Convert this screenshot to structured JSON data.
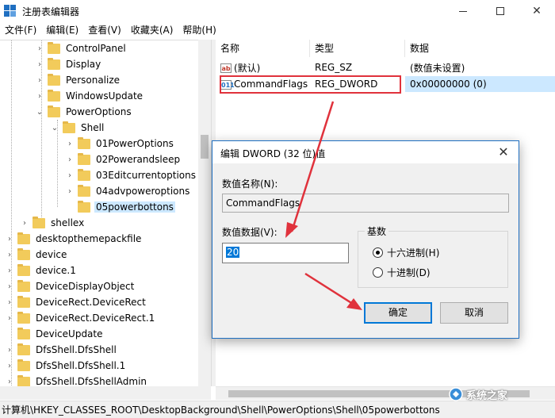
{
  "window": {
    "title": "注册表编辑器",
    "min_label": "",
    "close_label": "✕"
  },
  "menu": [
    "文件(F)",
    "编辑(E)",
    "查看(V)",
    "收藏夹(A)",
    "帮助(H)"
  ],
  "tree": {
    "items": [
      {
        "label": "ControlPanel",
        "expander": "›"
      },
      {
        "label": "Display",
        "expander": "›"
      },
      {
        "label": "Personalize",
        "expander": "›"
      },
      {
        "label": "WindowsUpdate",
        "expander": "›"
      },
      {
        "label": "PowerOptions",
        "expander": "⌄"
      },
      {
        "label": "Shell",
        "expander": "⌄"
      },
      {
        "label": "01PowerOptions",
        "expander": "›"
      },
      {
        "label": "02Powerandsleep",
        "expander": "›"
      },
      {
        "label": "03Editcurrentoptions",
        "expander": "›"
      },
      {
        "label": "04advpoweroptions",
        "expander": "›"
      },
      {
        "label": "05powerbottons",
        "expander": ""
      },
      {
        "label": "shellex",
        "expander": "›"
      },
      {
        "label": "desktopthemepackfile",
        "expander": "›"
      },
      {
        "label": "device",
        "expander": "›"
      },
      {
        "label": "device.1",
        "expander": "›"
      },
      {
        "label": "DeviceDisplayObject",
        "expander": "›"
      },
      {
        "label": "DeviceRect.DeviceRect",
        "expander": "›"
      },
      {
        "label": "DeviceRect.DeviceRect.1",
        "expander": "›"
      },
      {
        "label": "DeviceUpdate",
        "expander": ""
      },
      {
        "label": "DfsShell.DfsShell",
        "expander": "›"
      },
      {
        "label": "DfsShell.DfsShell.1",
        "expander": "›"
      },
      {
        "label": "DfsShell.DfsShellAdmin",
        "expander": "›"
      }
    ]
  },
  "list": {
    "headers": {
      "name": "名称",
      "type": "类型",
      "data": "数据"
    },
    "rows": [
      {
        "icon": "ab",
        "name": "(默认)",
        "type": "REG_SZ",
        "data": "(数值未设置)"
      },
      {
        "icon": "011",
        "name": "CommandFlags",
        "type": "REG_DWORD",
        "data": "0x00000000 (0)"
      }
    ]
  },
  "statusbar": {
    "path": "计算机\\HKEY_CLASSES_ROOT\\DesktopBackground\\Shell\\PowerOptions\\Shell\\05powerbottons"
  },
  "dialog": {
    "title": "编辑 DWORD (32 位)值",
    "close": "✕",
    "name_label": "数值名称(N):",
    "name_value": "CommandFlags",
    "data_label": "数值数据(V):",
    "data_value": "20",
    "base_label": "基数",
    "hex_label": "十六进制(H)",
    "dec_label": "十进制(D)",
    "ok_label": "确定",
    "cancel_label": "取消"
  },
  "watermark": {
    "text": "系统之家"
  },
  "colors": {
    "accent": "#0078d7",
    "highlight_box": "#e0323c",
    "arrow": "#e0323c"
  }
}
